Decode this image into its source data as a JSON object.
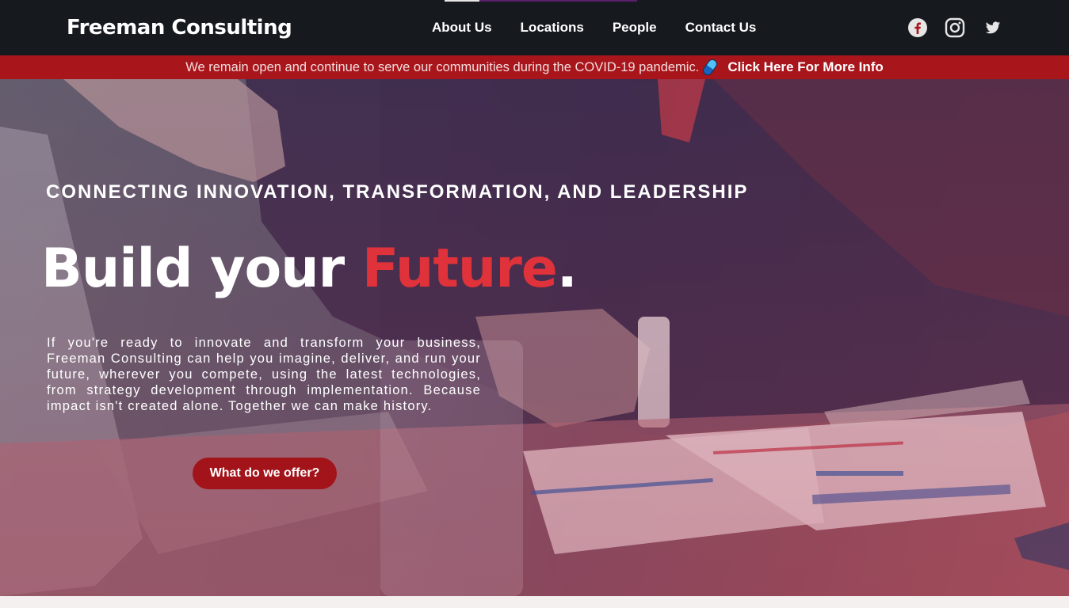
{
  "header": {
    "brand": "Freeman Consulting",
    "nav": [
      "About Us",
      "Locations",
      "People",
      "Contact Us"
    ],
    "social": [
      "facebook-icon",
      "instagram-icon",
      "twitter-icon"
    ],
    "scroll_progress": 0.18
  },
  "banner": {
    "message": "We remain open and continue to serve our communities during the COVID-19 pandemic.",
    "icon": "pill-icon",
    "link": "Click Here For More Info"
  },
  "hero": {
    "eyebrow": "CONNECTING INNOVATION, TRANSFORMATION, AND LEADERSHIP",
    "headline_start": "Build your ",
    "headline_accent": "Future",
    "headline_end": ".",
    "body": "If you're ready to innovate and transform your business, Freeman Consulting can help you imagine, deliver, and run your future, wherever you compete, using the latest technologies, from strategy development through implementation. Because impact isn't created alone. Together we can make history.",
    "cta": "What do we offer?"
  },
  "colors": {
    "nav_bg": "#161a1e",
    "banner_bg": "#a8161c",
    "accent": "#e0323a",
    "cta_bg": "#a3131a"
  }
}
